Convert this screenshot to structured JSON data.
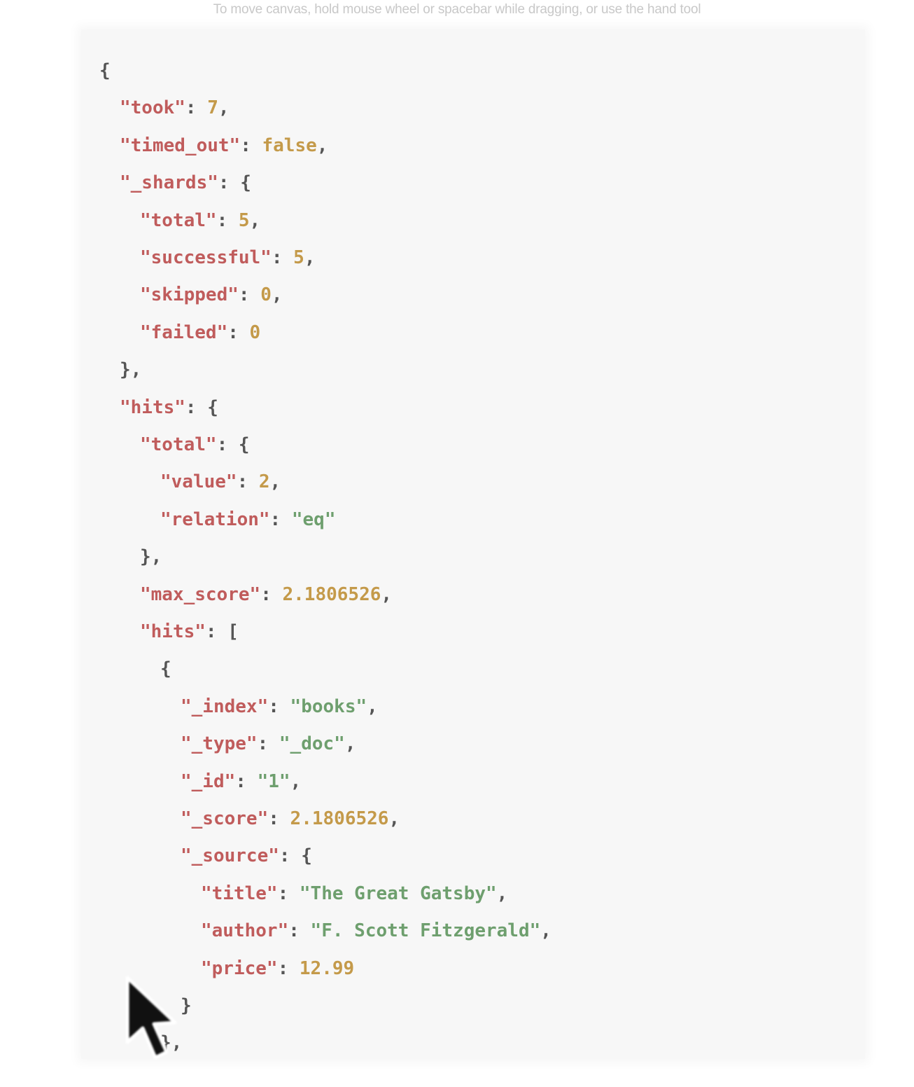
{
  "hint": "To move canvas, hold mouse wheel or spacebar while dragging, or use the hand tool",
  "colors": {
    "panel_bg": "#f7f7f7",
    "key": "#c05c5c",
    "number": "#c49a4a",
    "string": "#6e9f6e",
    "punctuation": "#555555"
  },
  "lines": [
    {
      "indent": 0,
      "tokens": [
        [
          "punc",
          "{"
        ]
      ]
    },
    {
      "indent": 1,
      "tokens": [
        [
          "key",
          "\"took\""
        ],
        [
          "punc",
          ": "
        ],
        [
          "num",
          "7"
        ],
        [
          "punc",
          ","
        ]
      ]
    },
    {
      "indent": 1,
      "tokens": [
        [
          "key",
          "\"timed_out\""
        ],
        [
          "punc",
          ": "
        ],
        [
          "kw",
          "false"
        ],
        [
          "punc",
          ","
        ]
      ]
    },
    {
      "indent": 1,
      "tokens": [
        [
          "key",
          "\"_shards\""
        ],
        [
          "punc",
          ": {"
        ]
      ]
    },
    {
      "indent": 2,
      "tokens": [
        [
          "key",
          "\"total\""
        ],
        [
          "punc",
          ": "
        ],
        [
          "num",
          "5"
        ],
        [
          "punc",
          ","
        ]
      ]
    },
    {
      "indent": 2,
      "tokens": [
        [
          "key",
          "\"successful\""
        ],
        [
          "punc",
          ": "
        ],
        [
          "num",
          "5"
        ],
        [
          "punc",
          ","
        ]
      ]
    },
    {
      "indent": 2,
      "tokens": [
        [
          "key",
          "\"skipped\""
        ],
        [
          "punc",
          ": "
        ],
        [
          "num",
          "0"
        ],
        [
          "punc",
          ","
        ]
      ]
    },
    {
      "indent": 2,
      "tokens": [
        [
          "key",
          "\"failed\""
        ],
        [
          "punc",
          ": "
        ],
        [
          "num",
          "0"
        ]
      ]
    },
    {
      "indent": 1,
      "tokens": [
        [
          "punc",
          "},"
        ]
      ]
    },
    {
      "indent": 1,
      "tokens": [
        [
          "key",
          "\"hits\""
        ],
        [
          "punc",
          ": {"
        ]
      ]
    },
    {
      "indent": 2,
      "tokens": [
        [
          "key",
          "\"total\""
        ],
        [
          "punc",
          ": {"
        ]
      ]
    },
    {
      "indent": 3,
      "tokens": [
        [
          "key",
          "\"value\""
        ],
        [
          "punc",
          ": "
        ],
        [
          "num",
          "2"
        ],
        [
          "punc",
          ","
        ]
      ]
    },
    {
      "indent": 3,
      "tokens": [
        [
          "key",
          "\"relation\""
        ],
        [
          "punc",
          ": "
        ],
        [
          "str",
          "\"eq\""
        ]
      ]
    },
    {
      "indent": 2,
      "tokens": [
        [
          "punc",
          "},"
        ]
      ]
    },
    {
      "indent": 2,
      "tokens": [
        [
          "key",
          "\"max_score\""
        ],
        [
          "punc",
          ": "
        ],
        [
          "num",
          "2.1806526"
        ],
        [
          "punc",
          ","
        ]
      ]
    },
    {
      "indent": 2,
      "tokens": [
        [
          "key",
          "\"hits\""
        ],
        [
          "punc",
          ": ["
        ]
      ]
    },
    {
      "indent": 3,
      "tokens": [
        [
          "punc",
          "{"
        ]
      ]
    },
    {
      "indent": 4,
      "tokens": [
        [
          "key",
          "\"_index\""
        ],
        [
          "punc",
          ": "
        ],
        [
          "str",
          "\"books\""
        ],
        [
          "punc",
          ","
        ]
      ]
    },
    {
      "indent": 4,
      "tokens": [
        [
          "key",
          "\"_type\""
        ],
        [
          "punc",
          ": "
        ],
        [
          "str",
          "\"_doc\""
        ],
        [
          "punc",
          ","
        ]
      ]
    },
    {
      "indent": 4,
      "tokens": [
        [
          "key",
          "\"_id\""
        ],
        [
          "punc",
          ": "
        ],
        [
          "str",
          "\"1\""
        ],
        [
          "punc",
          ","
        ]
      ]
    },
    {
      "indent": 4,
      "tokens": [
        [
          "key",
          "\"_score\""
        ],
        [
          "punc",
          ": "
        ],
        [
          "num",
          "2.1806526"
        ],
        [
          "punc",
          ","
        ]
      ]
    },
    {
      "indent": 4,
      "tokens": [
        [
          "key",
          "\"_source\""
        ],
        [
          "punc",
          ": {"
        ]
      ]
    },
    {
      "indent": 5,
      "tokens": [
        [
          "key",
          "\"title\""
        ],
        [
          "punc",
          ": "
        ],
        [
          "str",
          "\"The Great Gatsby\""
        ],
        [
          "punc",
          ","
        ]
      ]
    },
    {
      "indent": 5,
      "tokens": [
        [
          "key",
          "\"author\""
        ],
        [
          "punc",
          ": "
        ],
        [
          "str",
          "\"F. Scott Fitzgerald\""
        ],
        [
          "punc",
          ","
        ]
      ]
    },
    {
      "indent": 5,
      "tokens": [
        [
          "key",
          "\"price\""
        ],
        [
          "punc",
          ": "
        ],
        [
          "num",
          "12.99"
        ]
      ]
    },
    {
      "indent": 4,
      "tokens": [
        [
          "punc",
          "}"
        ]
      ]
    },
    {
      "indent": 3,
      "tokens": [
        [
          "punc",
          "},"
        ]
      ]
    }
  ]
}
